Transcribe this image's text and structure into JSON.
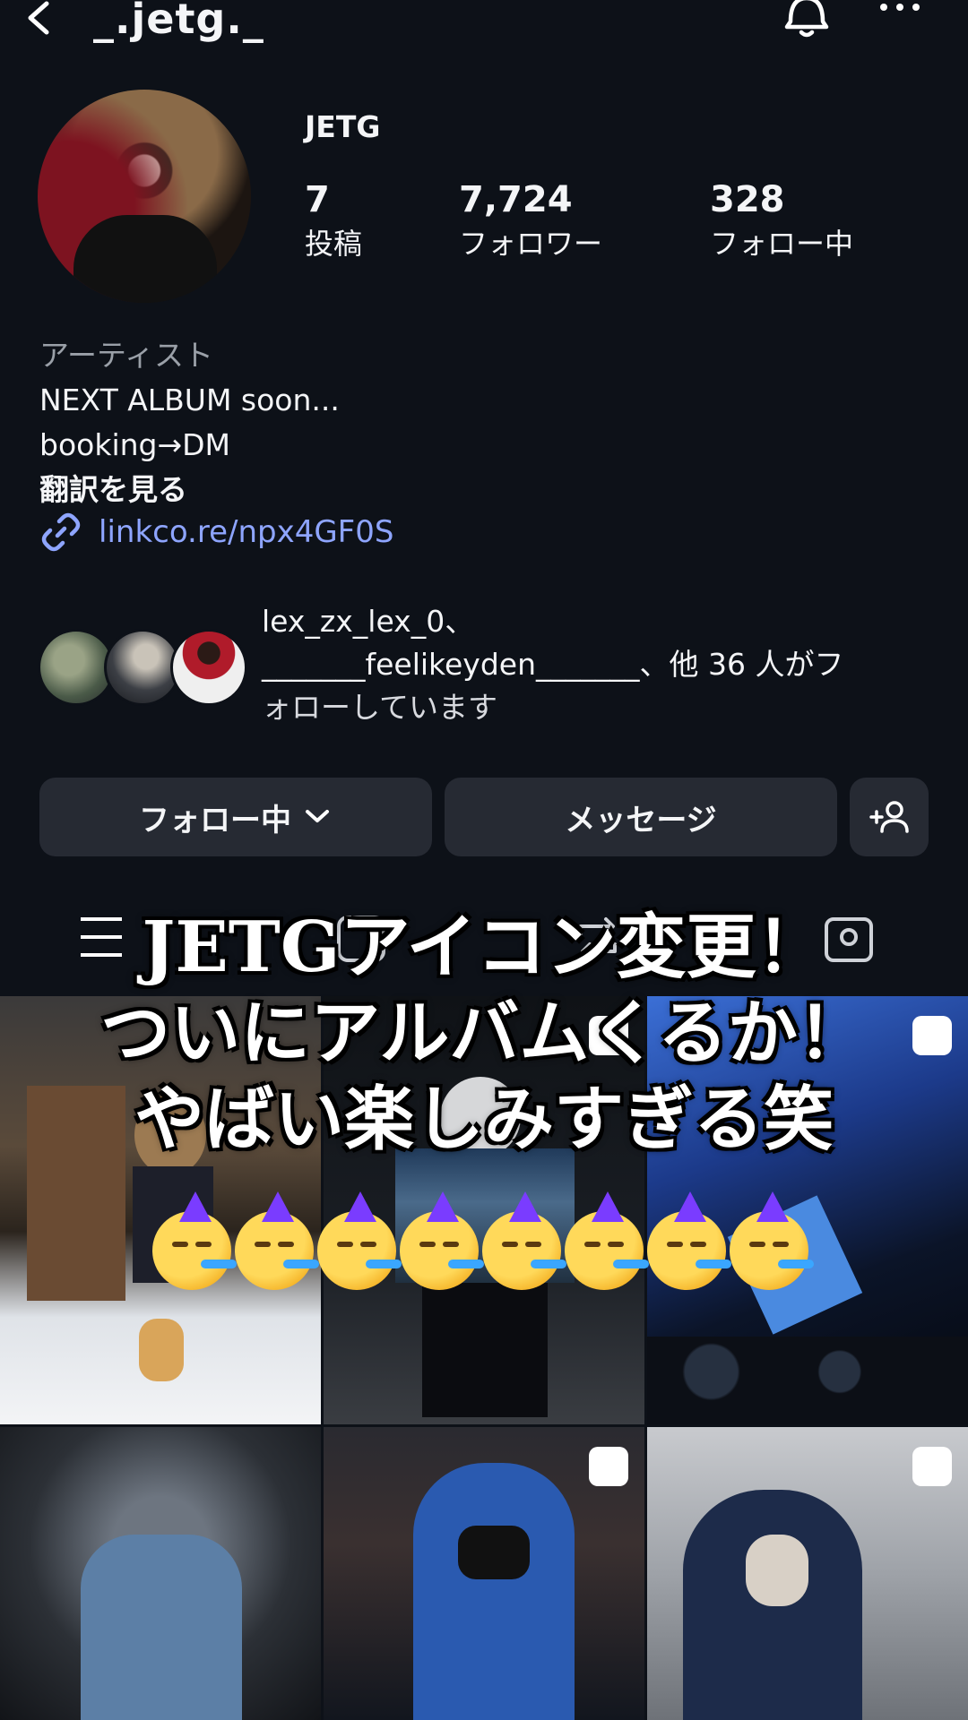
{
  "header": {
    "handle": "_.jetg._"
  },
  "profile": {
    "display_name": "JETG",
    "stats": [
      {
        "value": "7",
        "label": "投稿"
      },
      {
        "value": "7,724",
        "label": "フォロワー"
      },
      {
        "value": "328",
        "label": "フォロー中"
      }
    ],
    "category": "アーティスト",
    "bio_lines": [
      "NEXT ALBUM soon...",
      "booking→DM"
    ],
    "see_translation": "翻訳を見る",
    "link": "linkco.re/npx4GF0S"
  },
  "mutuals": {
    "line1": "lex_zx_lex_0、",
    "line2": "_______feelikeyden_______、他 36 人がフ",
    "line3": "ォローしています"
  },
  "actions": {
    "following_label": "フォロー中",
    "message_label": "メッセージ"
  },
  "overlay": {
    "line1": "JETGアイコン変更！",
    "line2": "ついにアルバムくるか！",
    "line3": "やばい楽しみすぎる笑",
    "emoji": "🥳",
    "emoji_count": 8
  },
  "colors": {
    "background": "#0d1118",
    "button": "#262a33",
    "link": "#8ea5ff"
  }
}
